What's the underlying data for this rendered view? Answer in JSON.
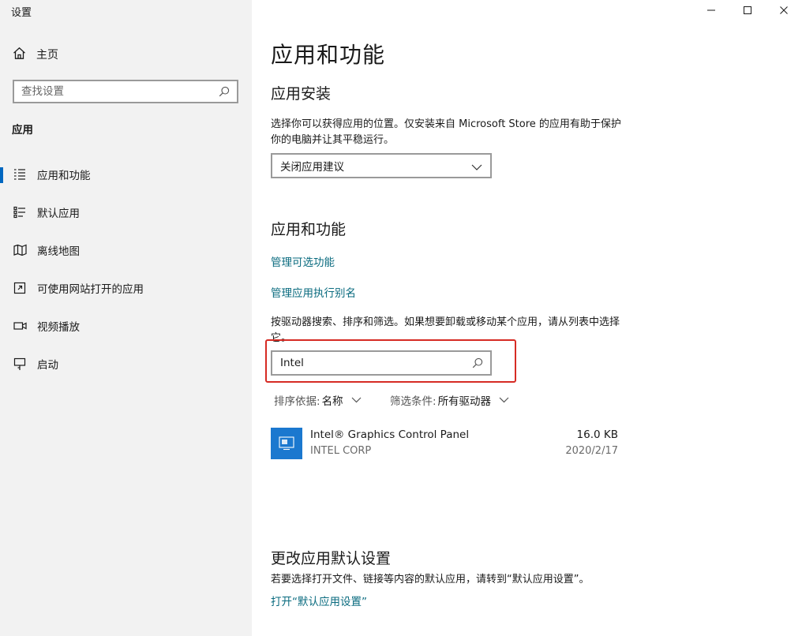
{
  "window": {
    "title": "设置",
    "minimize": "minimize",
    "maximize": "maximize",
    "close": "close"
  },
  "sidebar": {
    "home_label": "主页",
    "search_placeholder": "查找设置",
    "section_title": "应用",
    "items": [
      {
        "label": "应用和功能",
        "icon": "apps-list-icon",
        "active": true
      },
      {
        "label": "默认应用",
        "icon": "default-apps-icon",
        "active": false
      },
      {
        "label": "离线地图",
        "icon": "map-icon",
        "active": false
      },
      {
        "label": "可使用网站打开的应用",
        "icon": "open-website-icon",
        "active": false
      },
      {
        "label": "视频播放",
        "icon": "video-icon",
        "active": false
      },
      {
        "label": "启动",
        "icon": "startup-icon",
        "active": false
      }
    ]
  },
  "main": {
    "page_title": "应用和功能",
    "install": {
      "heading": "应用安装",
      "description": "选择你可以获得应用的位置。仅安装来自 Microsoft Store 的应用有助于保护你的电脑并让其平稳运行。",
      "dropdown_value": "关闭应用建议"
    },
    "features": {
      "heading": "应用和功能",
      "link_optional": "管理可选功能",
      "link_alias": "管理应用执行别名",
      "description": "按驱动器搜索、排序和筛选。如果想要卸载或移动某个应用，请从列表中选择它。",
      "search_value": "Intel",
      "sort_key": "排序依据:",
      "sort_value": "名称",
      "filter_key": "筛选条件:",
      "filter_value": "所有驱动器"
    },
    "apps": [
      {
        "name": "Intel® Graphics Control Panel",
        "publisher": "INTEL CORP",
        "size": "16.0 KB",
        "date": "2020/2/17"
      }
    ],
    "defaults": {
      "heading": "更改应用默认设置",
      "description": "若要选择打开文件、链接等内容的默认应用，请转到“默认应用设置”。",
      "link": "打开“默认应用设置”"
    }
  },
  "colors": {
    "sidebar_bg": "#f2f2f2",
    "accent": "#0067c0",
    "link": "#0a6b7f",
    "highlight": "#d62b24",
    "app_icon_bg": "#1b78cf"
  }
}
